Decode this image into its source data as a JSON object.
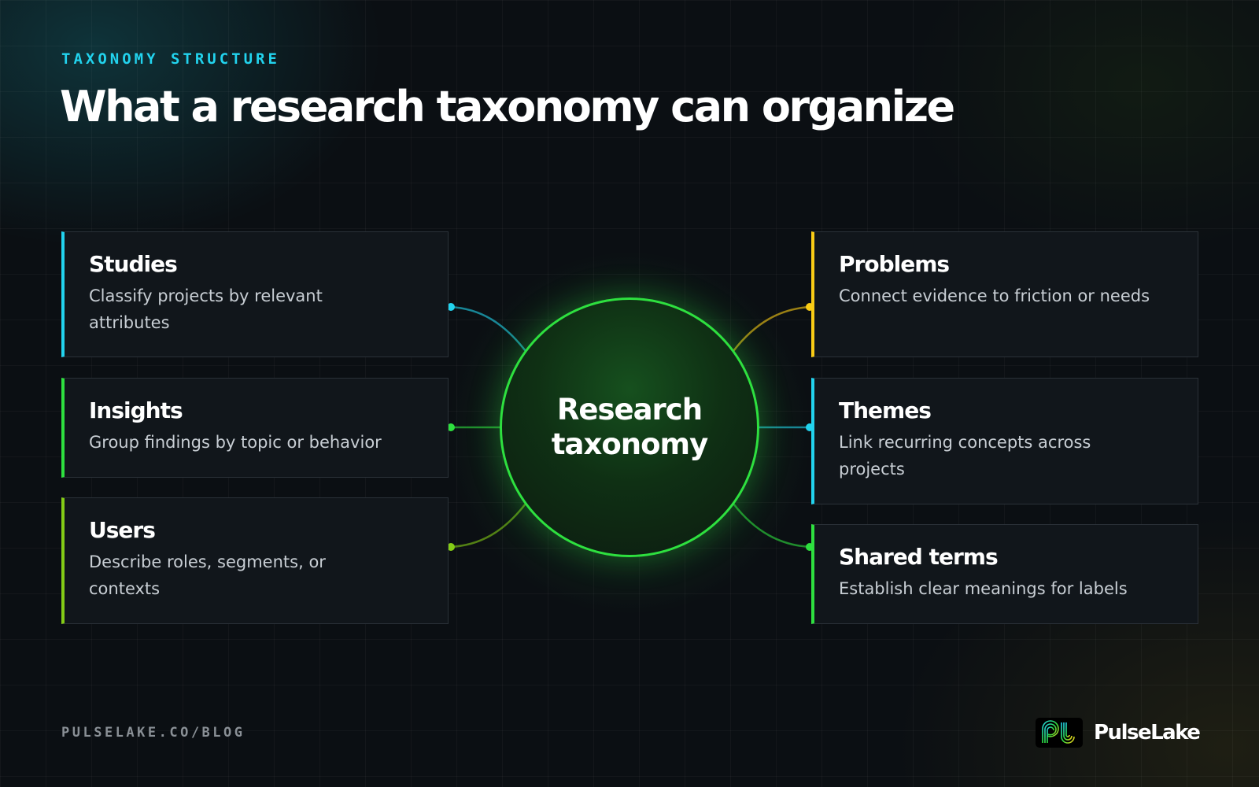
{
  "header": {
    "eyebrow": "TAXONOMY STRUCTURE",
    "title": "What a research taxonomy can organize"
  },
  "hub": {
    "label": "Research taxonomy",
    "color": "#2ee03f"
  },
  "left_cards": [
    {
      "title": "Studies",
      "description": "Classify projects by relevant attributes",
      "accent": "#22d3ee"
    },
    {
      "title": "Insights",
      "description": "Group findings by topic or behavior",
      "accent": "#2ee03f"
    },
    {
      "title": "Users",
      "description": "Describe roles, segments, or contexts",
      "accent": "#84cc16"
    }
  ],
  "right_cards": [
    {
      "title": "Problems",
      "description": "Connect evidence to friction or needs",
      "accent": "#facc15"
    },
    {
      "title": "Themes",
      "description": "Link recurring concepts across projects",
      "accent": "#22d3ee"
    },
    {
      "title": "Shared terms",
      "description": "Establish clear meanings for labels",
      "accent": "#2ee03f"
    }
  ],
  "footer": {
    "url": "PULSELAKE.CO/BLOG",
    "brand": "PulseLake"
  }
}
